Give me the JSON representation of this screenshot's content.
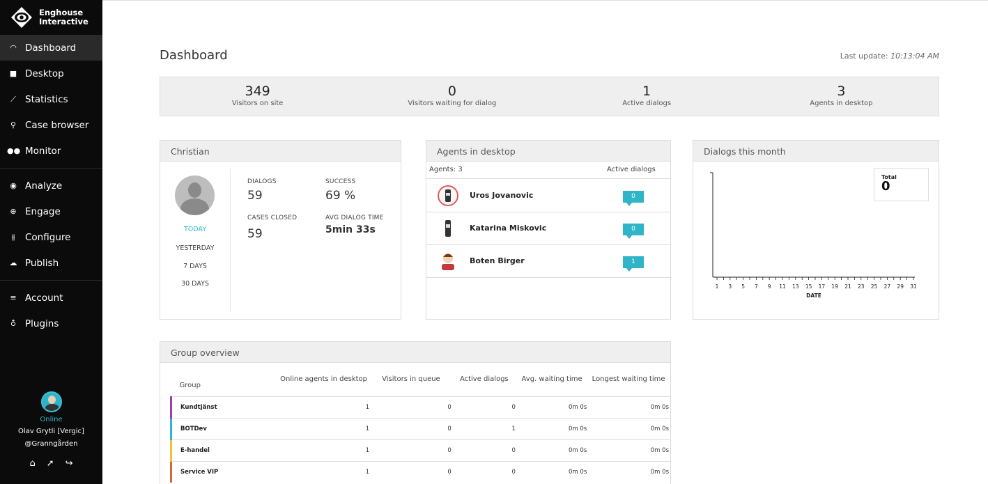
{
  "sidebar": {
    "brand_line1": "Enghouse",
    "brand_line2": "Interactive",
    "items": [
      {
        "label": "Dashboard",
        "icon": "gauge-icon"
      },
      {
        "label": "Desktop",
        "icon": "chat-icon"
      },
      {
        "label": "Statistics",
        "icon": "trend-icon"
      },
      {
        "label": "Case browser",
        "icon": "search-icon"
      },
      {
        "label": "Monitor",
        "icon": "binoculars-icon"
      },
      {
        "label": "Analyze",
        "icon": "eye-icon"
      },
      {
        "label": "Engage",
        "icon": "target-icon"
      },
      {
        "label": "Configure",
        "icon": "sliders-icon"
      },
      {
        "label": "Publish",
        "icon": "cloud-icon"
      },
      {
        "label": "Account",
        "icon": "layers-icon"
      },
      {
        "label": "Plugins",
        "icon": "bulb-icon"
      }
    ],
    "user": {
      "status": "Online",
      "name_line1": "Olav Grytli [Vergic]",
      "name_line2": "@Granngården"
    }
  },
  "header": {
    "title": "Dashboard",
    "last_update_label": "Last update:",
    "last_update_time": "10:13:04 AM"
  },
  "stats": [
    {
      "value": "349",
      "label": "Visitors on site"
    },
    {
      "value": "0",
      "label": "Visitors waiting for dialog"
    },
    {
      "value": "1",
      "label": "Active dialogs"
    },
    {
      "value": "3",
      "label": "Agents in desktop"
    }
  ],
  "christian": {
    "title": "Christian",
    "periods": [
      "TODAY",
      "YESTERDAY",
      "7 DAYS",
      "30 DAYS"
    ],
    "dialogs_label": "DIALOGS",
    "dialogs_value": "59",
    "success_label": "SUCCESS",
    "success_value": "69 %",
    "cases_label": "CASES CLOSED",
    "cases_value": "59",
    "avg_label": "AVG DIALOG TIME",
    "avg_value": "5min 33s"
  },
  "agents": {
    "title": "Agents in desktop",
    "count_label": "Agents: 3",
    "col_label": "Active dialogs",
    "rows": [
      {
        "name": "Uros Jovanovic",
        "dialogs": "0"
      },
      {
        "name": "Katarina Miskovic",
        "dialogs": "0"
      },
      {
        "name": "Boten Birger",
        "dialogs": "1"
      }
    ]
  },
  "dialogs_month": {
    "title": "Dialogs this month",
    "total_label": "Total",
    "total_value": "0"
  },
  "chart_data": {
    "type": "line",
    "x": [
      1,
      2,
      3,
      4,
      5,
      6,
      7,
      8,
      9,
      10,
      11,
      12,
      13,
      14,
      15,
      16,
      17,
      18,
      19,
      20,
      21,
      22,
      23,
      24,
      25,
      26,
      27,
      28,
      29,
      30,
      31
    ],
    "tick_labels": [
      "1",
      "3",
      "5",
      "7",
      "9",
      "11",
      "13",
      "15",
      "17",
      "19",
      "21",
      "23",
      "25",
      "27",
      "29",
      "31"
    ],
    "xlabel": "DATE",
    "ylabel": "",
    "series": [],
    "grid": false
  },
  "group_overview": {
    "title": "Group overview",
    "columns": [
      "Group",
      "Online agents in desktop",
      "Visitors in queue",
      "Active dialogs",
      "Avg. waiting time",
      "Longest waiting time"
    ],
    "rows": [
      {
        "name": "Kundtjänst",
        "color": "#a23ea8",
        "values": [
          "1",
          "0",
          "0",
          "0m 0s",
          "0m 0s"
        ]
      },
      {
        "name": "BOTDev",
        "color": "#2fb4c8",
        "values": [
          "1",
          "0",
          "1",
          "0m 0s",
          "0m 0s"
        ]
      },
      {
        "name": "E-handel",
        "color": "#f0c23a",
        "values": [
          "1",
          "0",
          "0",
          "0m 0s",
          "0m 0s"
        ]
      },
      {
        "name": "Service VIP",
        "color": "#d2693a",
        "values": [
          "1",
          "0",
          "0",
          "0m 0s",
          "0m 0s"
        ]
      }
    ]
  }
}
